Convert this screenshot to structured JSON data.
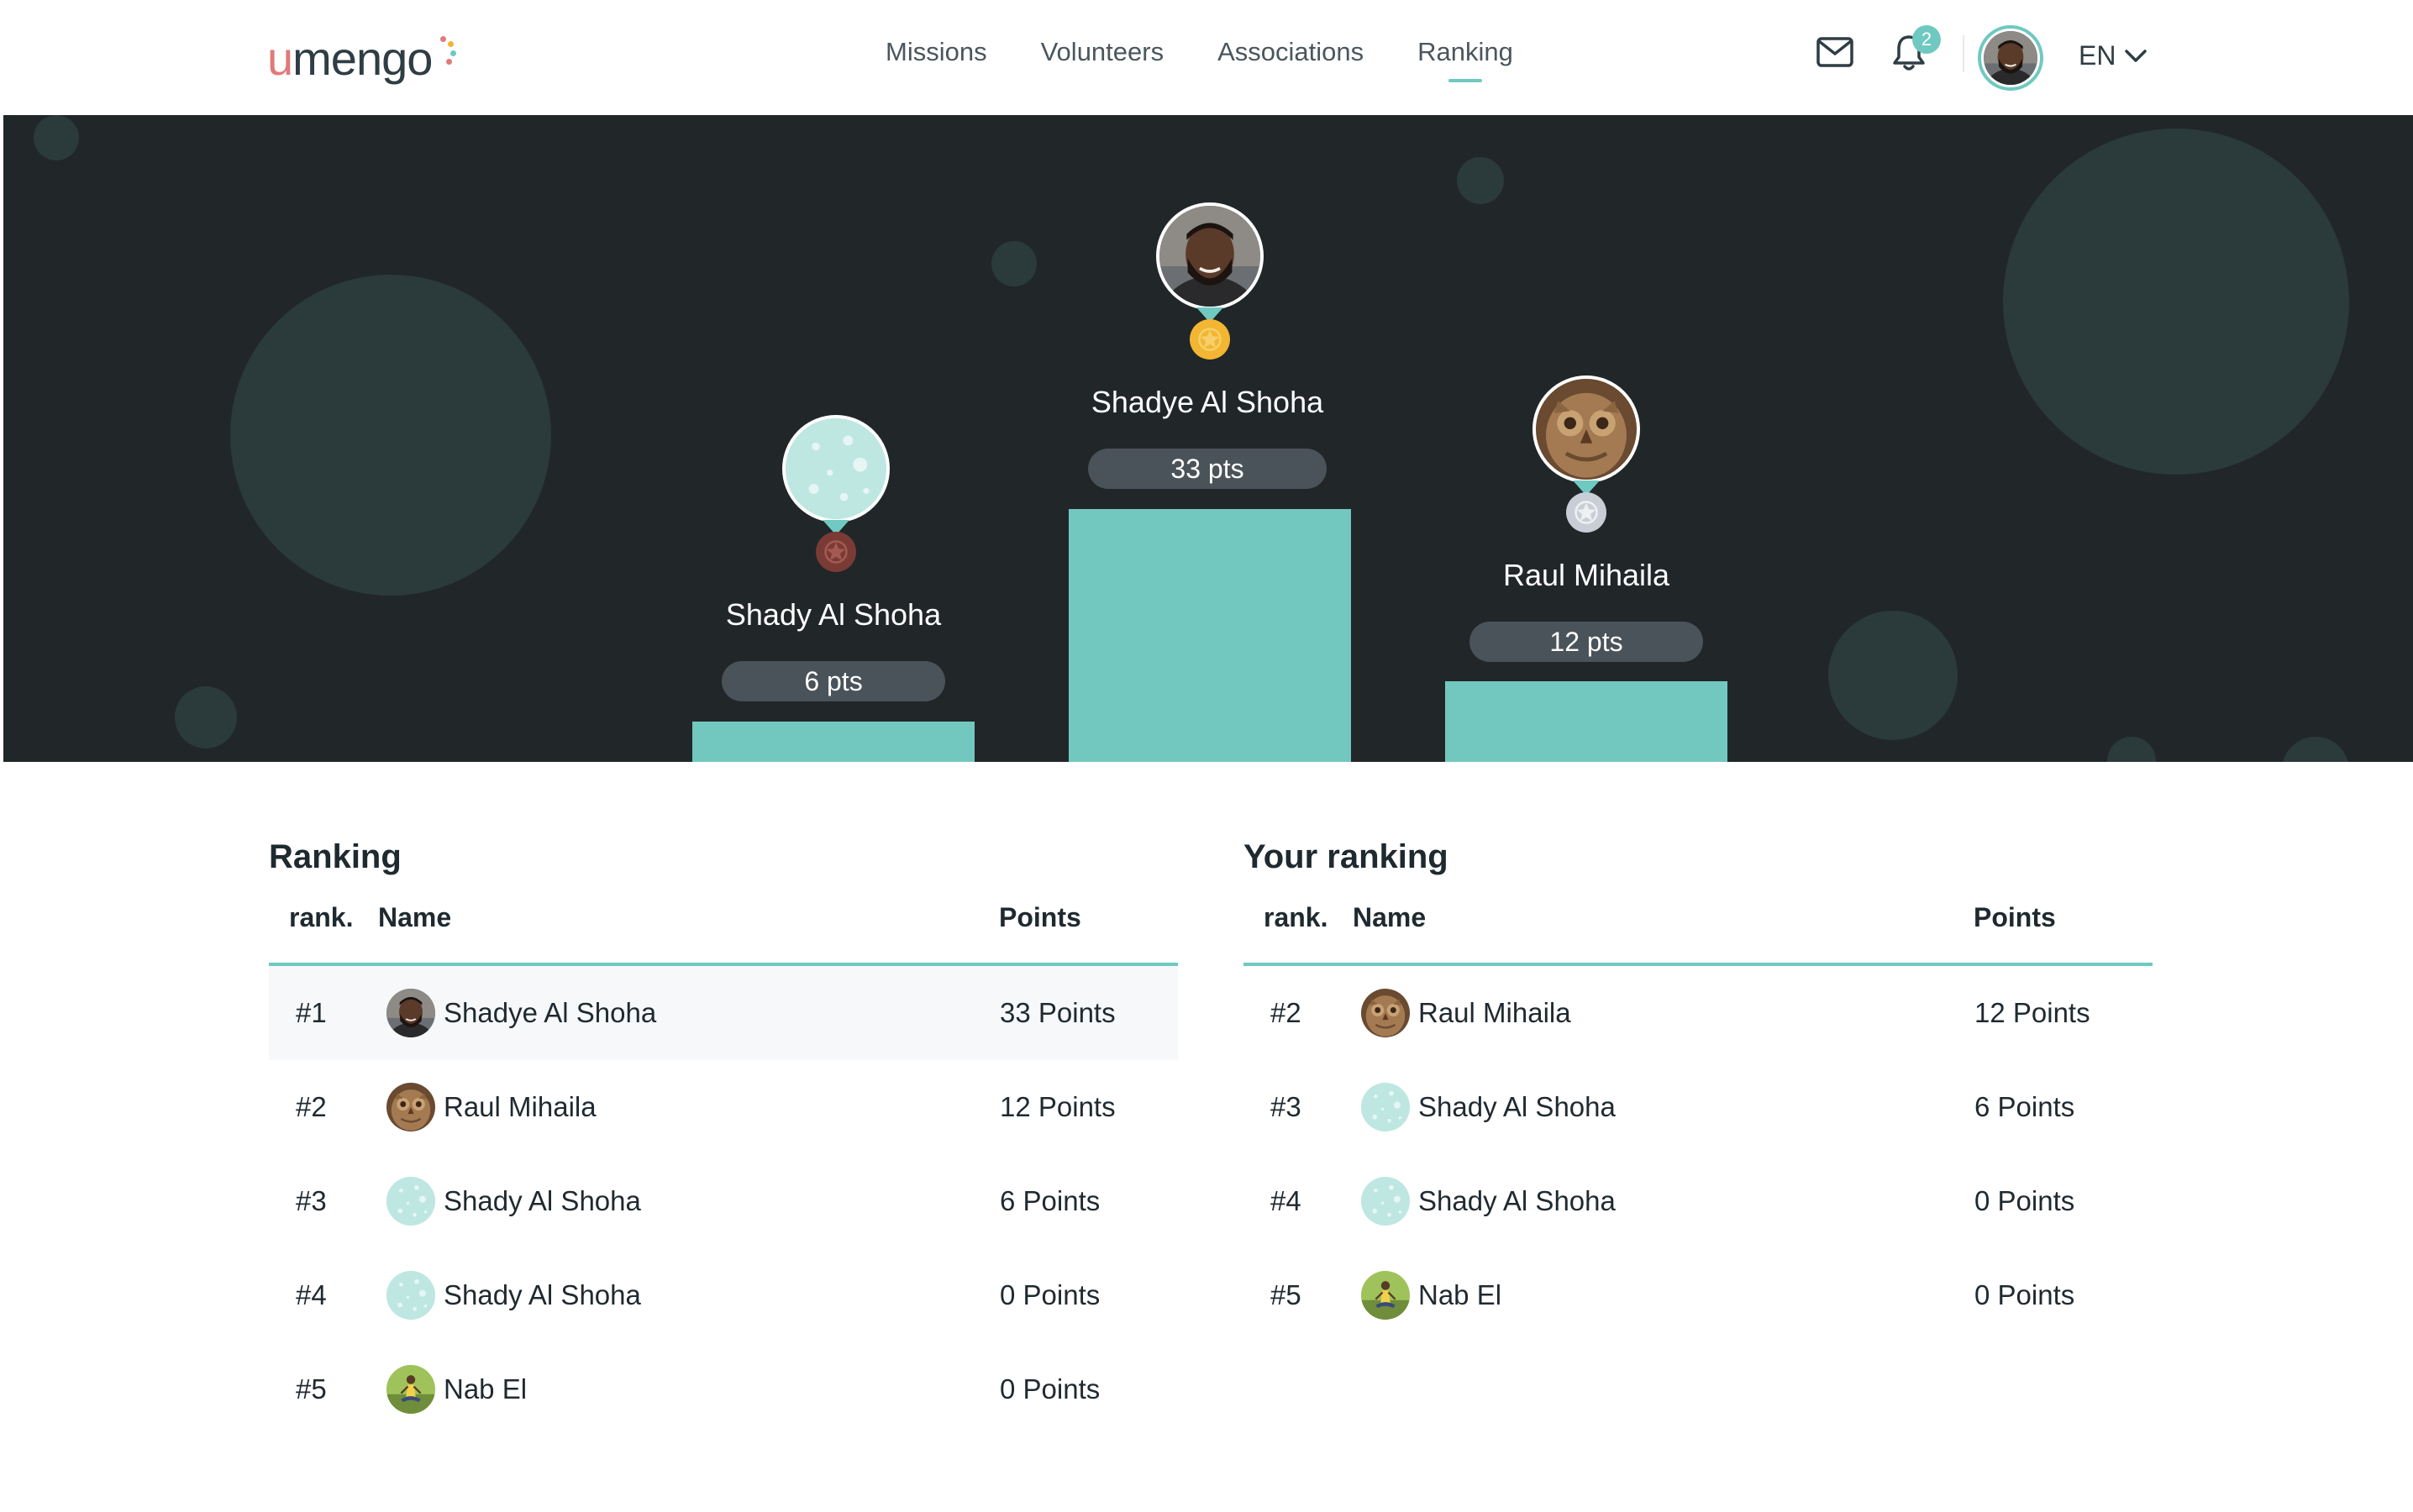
{
  "brand": {
    "logo_u": "u",
    "logo_rest": "mengo"
  },
  "nav": {
    "items": [
      {
        "label": "Missions"
      },
      {
        "label": "Volunteers"
      },
      {
        "label": "Associations"
      },
      {
        "label": "Ranking",
        "active": true
      }
    ]
  },
  "header": {
    "notifications_count": "2",
    "language": "EN",
    "icons": [
      "mail-icon",
      "bell-icon",
      "chevron-down-icon"
    ]
  },
  "podium": {
    "first": {
      "name": "Shadye Al Shoha",
      "points": "33 pts",
      "medal": "gold"
    },
    "second": {
      "name": "Raul Mihaila",
      "points": "12 pts",
      "medal": "silver"
    },
    "third": {
      "name": "Shady Al Shoha",
      "points": "6 pts",
      "medal": "bronze"
    }
  },
  "ranking": {
    "title": "Ranking",
    "columns": {
      "rank": "rank.",
      "name": "Name",
      "points": "Points"
    },
    "rows": [
      {
        "rank": "#1",
        "name": "Shadye Al Shoha",
        "points": "33 Points",
        "avatar": "man-photo"
      },
      {
        "rank": "#2",
        "name": "Raul Mihaila",
        "points": "12 Points",
        "avatar": "owl-photo"
      },
      {
        "rank": "#3",
        "name": "Shady Al Shoha",
        "points": "6 Points",
        "avatar": "default-bubbles"
      },
      {
        "rank": "#4",
        "name": "Shady Al Shoha",
        "points": "0 Points",
        "avatar": "default-bubbles"
      },
      {
        "rank": "#5",
        "name": "Nab El",
        "points": "0 Points",
        "avatar": "yoga-photo"
      }
    ]
  },
  "your_ranking": {
    "title": "Your ranking",
    "columns": {
      "rank": "rank.",
      "name": "Name",
      "points": "Points"
    },
    "rows": [
      {
        "rank": "#2",
        "name": "Raul Mihaila",
        "points": "12 Points",
        "avatar": "owl-photo"
      },
      {
        "rank": "#3",
        "name": "Shady Al Shoha",
        "points": "6 Points",
        "avatar": "default-bubbles"
      },
      {
        "rank": "#4",
        "name": "Shady Al Shoha",
        "points": "0 Points",
        "avatar": "default-bubbles"
      },
      {
        "rank": "#5",
        "name": "Nab El",
        "points": "0 Points",
        "avatar": "yoga-photo"
      }
    ]
  },
  "colors": {
    "accent": "#6fc9c0",
    "hero_bg": "#212629",
    "podium": "#72c8bf",
    "gold": "#f2b632",
    "silver": "#c9ced6",
    "bronze": "#7a3b36"
  }
}
